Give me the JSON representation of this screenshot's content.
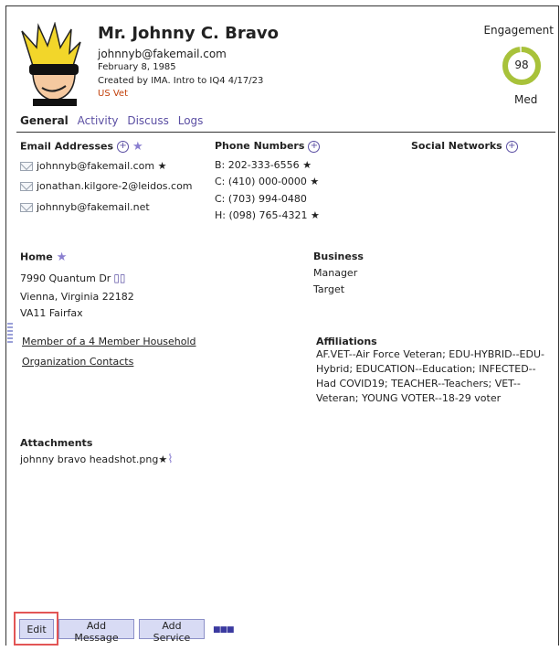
{
  "contact": {
    "name": "Mr. Johnny C. Bravo",
    "email": "johnnyb@fakemail.com",
    "dob": "February 8, 1985",
    "created": "Created by IMA. Intro to IQ4 4/17/23",
    "tag": "US Vet"
  },
  "engagement": {
    "label": "Engagement",
    "value": "98",
    "level": "Med",
    "fraction": 0.98,
    "ring_color": "#a8c23a"
  },
  "tabs": [
    "General",
    "Activity",
    "Discuss",
    "Logs"
  ],
  "email_section": {
    "title": "Email Addresses",
    "items": [
      "johnnyb@fakemail.com",
      "jonathan.kilgore-2@leidos.com",
      "johnnyb@fakemail.net"
    ]
  },
  "phone_section": {
    "title": "Phone Numbers",
    "items": [
      "B: 202-333-6556",
      "C: (410) 000-0000",
      "C: (703) 994-0480",
      "H: (098) 765-4321"
    ]
  },
  "social_section": {
    "title": "Social Networks"
  },
  "home": {
    "title": "Home",
    "street": "7990 Quantum Dr",
    "city": "Vienna, Virginia 22182",
    "district": "VA11 Fairfax"
  },
  "business": {
    "title": "Business",
    "line1": "Manager",
    "line2": "Target"
  },
  "links": {
    "household": "Member of a 4 Member Household",
    "org": "Organization Contacts"
  },
  "affiliations": {
    "title": "Affiliations",
    "text": "AF.VET--Air Force Veteran; EDU-HYBRID--EDU-Hybrid; EDUCATION--Education; INFECTED--Had COVID19; TEACHER--Teachers; VET--Veteran; YOUNG VOTER--18-29 voter"
  },
  "attachments": {
    "title": "Attachments",
    "file": "johnny bravo headshot.png"
  },
  "buttons": {
    "edit": "Edit",
    "add_message": "Add Message",
    "add_service": "Add Service"
  },
  "glyphs": {
    "plus": "+",
    "star": "★",
    "more": "■■■"
  }
}
